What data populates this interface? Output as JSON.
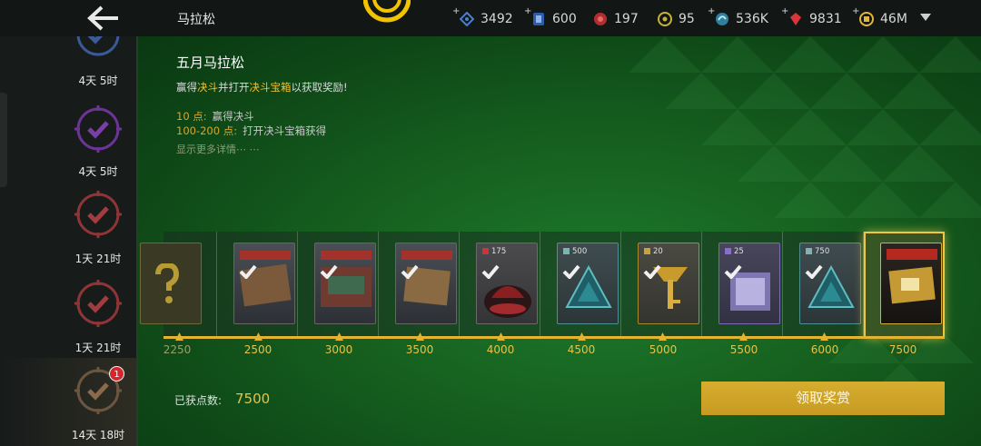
{
  "header": {
    "title": "马拉松",
    "resources": [
      {
        "icon": "blueprint-icon",
        "value": "3492",
        "color": "#4a7fd1"
      },
      {
        "icon": "card-icon",
        "value": "600",
        "color": "#3f7bd6"
      },
      {
        "icon": "red-token-icon",
        "value": "197",
        "color": "#d03b3b"
      },
      {
        "icon": "yellow-gear-icon",
        "value": "95",
        "color": "#c9b23a"
      },
      {
        "icon": "swirl-icon",
        "value": "536K",
        "color": "#5ab4d8"
      },
      {
        "icon": "ruby-icon",
        "value": "9831",
        "color": "#d8363b"
      },
      {
        "icon": "coin-icon",
        "value": "46M",
        "color": "#e3b53a"
      }
    ]
  },
  "sidebar": {
    "events": [
      {
        "time": "4天 5时",
        "color": "#3a5a9a"
      },
      {
        "time": "4天 5时",
        "color": "#7a3fa6"
      },
      {
        "time": "1天 21时",
        "color": "#a33c3f"
      },
      {
        "time": "1天 21时",
        "color": "#a33c3f"
      },
      {
        "time": "14天 18时",
        "color": "#8a6a4a",
        "badge": "1"
      }
    ]
  },
  "event": {
    "title": "五月马拉松",
    "desc_prefix": "赢得",
    "desc_hl1": "决斗",
    "desc_mid": "并打开",
    "desc_hl2": "决斗宝箱",
    "desc_suffix": "以获取奖励!",
    "rules": [
      {
        "points": "10 点:",
        "text": "赢得决斗"
      },
      {
        "points": "100-200 点:",
        "text": "打开决斗宝箱获得"
      }
    ],
    "more": "显示更多详情⋯ ⋯"
  },
  "rewards": [
    {
      "milestone": "2250",
      "kind": "mystery",
      "qty": ""
    },
    {
      "milestone": "2500",
      "kind": "chest",
      "qty": ""
    },
    {
      "milestone": "3000",
      "kind": "chest",
      "qty": ""
    },
    {
      "milestone": "3500",
      "kind": "chest",
      "qty": ""
    },
    {
      "milestone": "4000",
      "kind": "bag",
      "qty": "175"
    },
    {
      "milestone": "4500",
      "kind": "triangle",
      "qty": "500"
    },
    {
      "milestone": "5000",
      "kind": "key",
      "qty": "20"
    },
    {
      "milestone": "5500",
      "kind": "crate",
      "qty": "25"
    },
    {
      "milestone": "6000",
      "kind": "triangle",
      "qty": "750"
    },
    {
      "milestone": "7500",
      "kind": "chest-gold",
      "qty": ""
    }
  ],
  "footer": {
    "earned_label": "已获点数:",
    "earned_value": "7500",
    "claim_label": "领取奖赏"
  }
}
